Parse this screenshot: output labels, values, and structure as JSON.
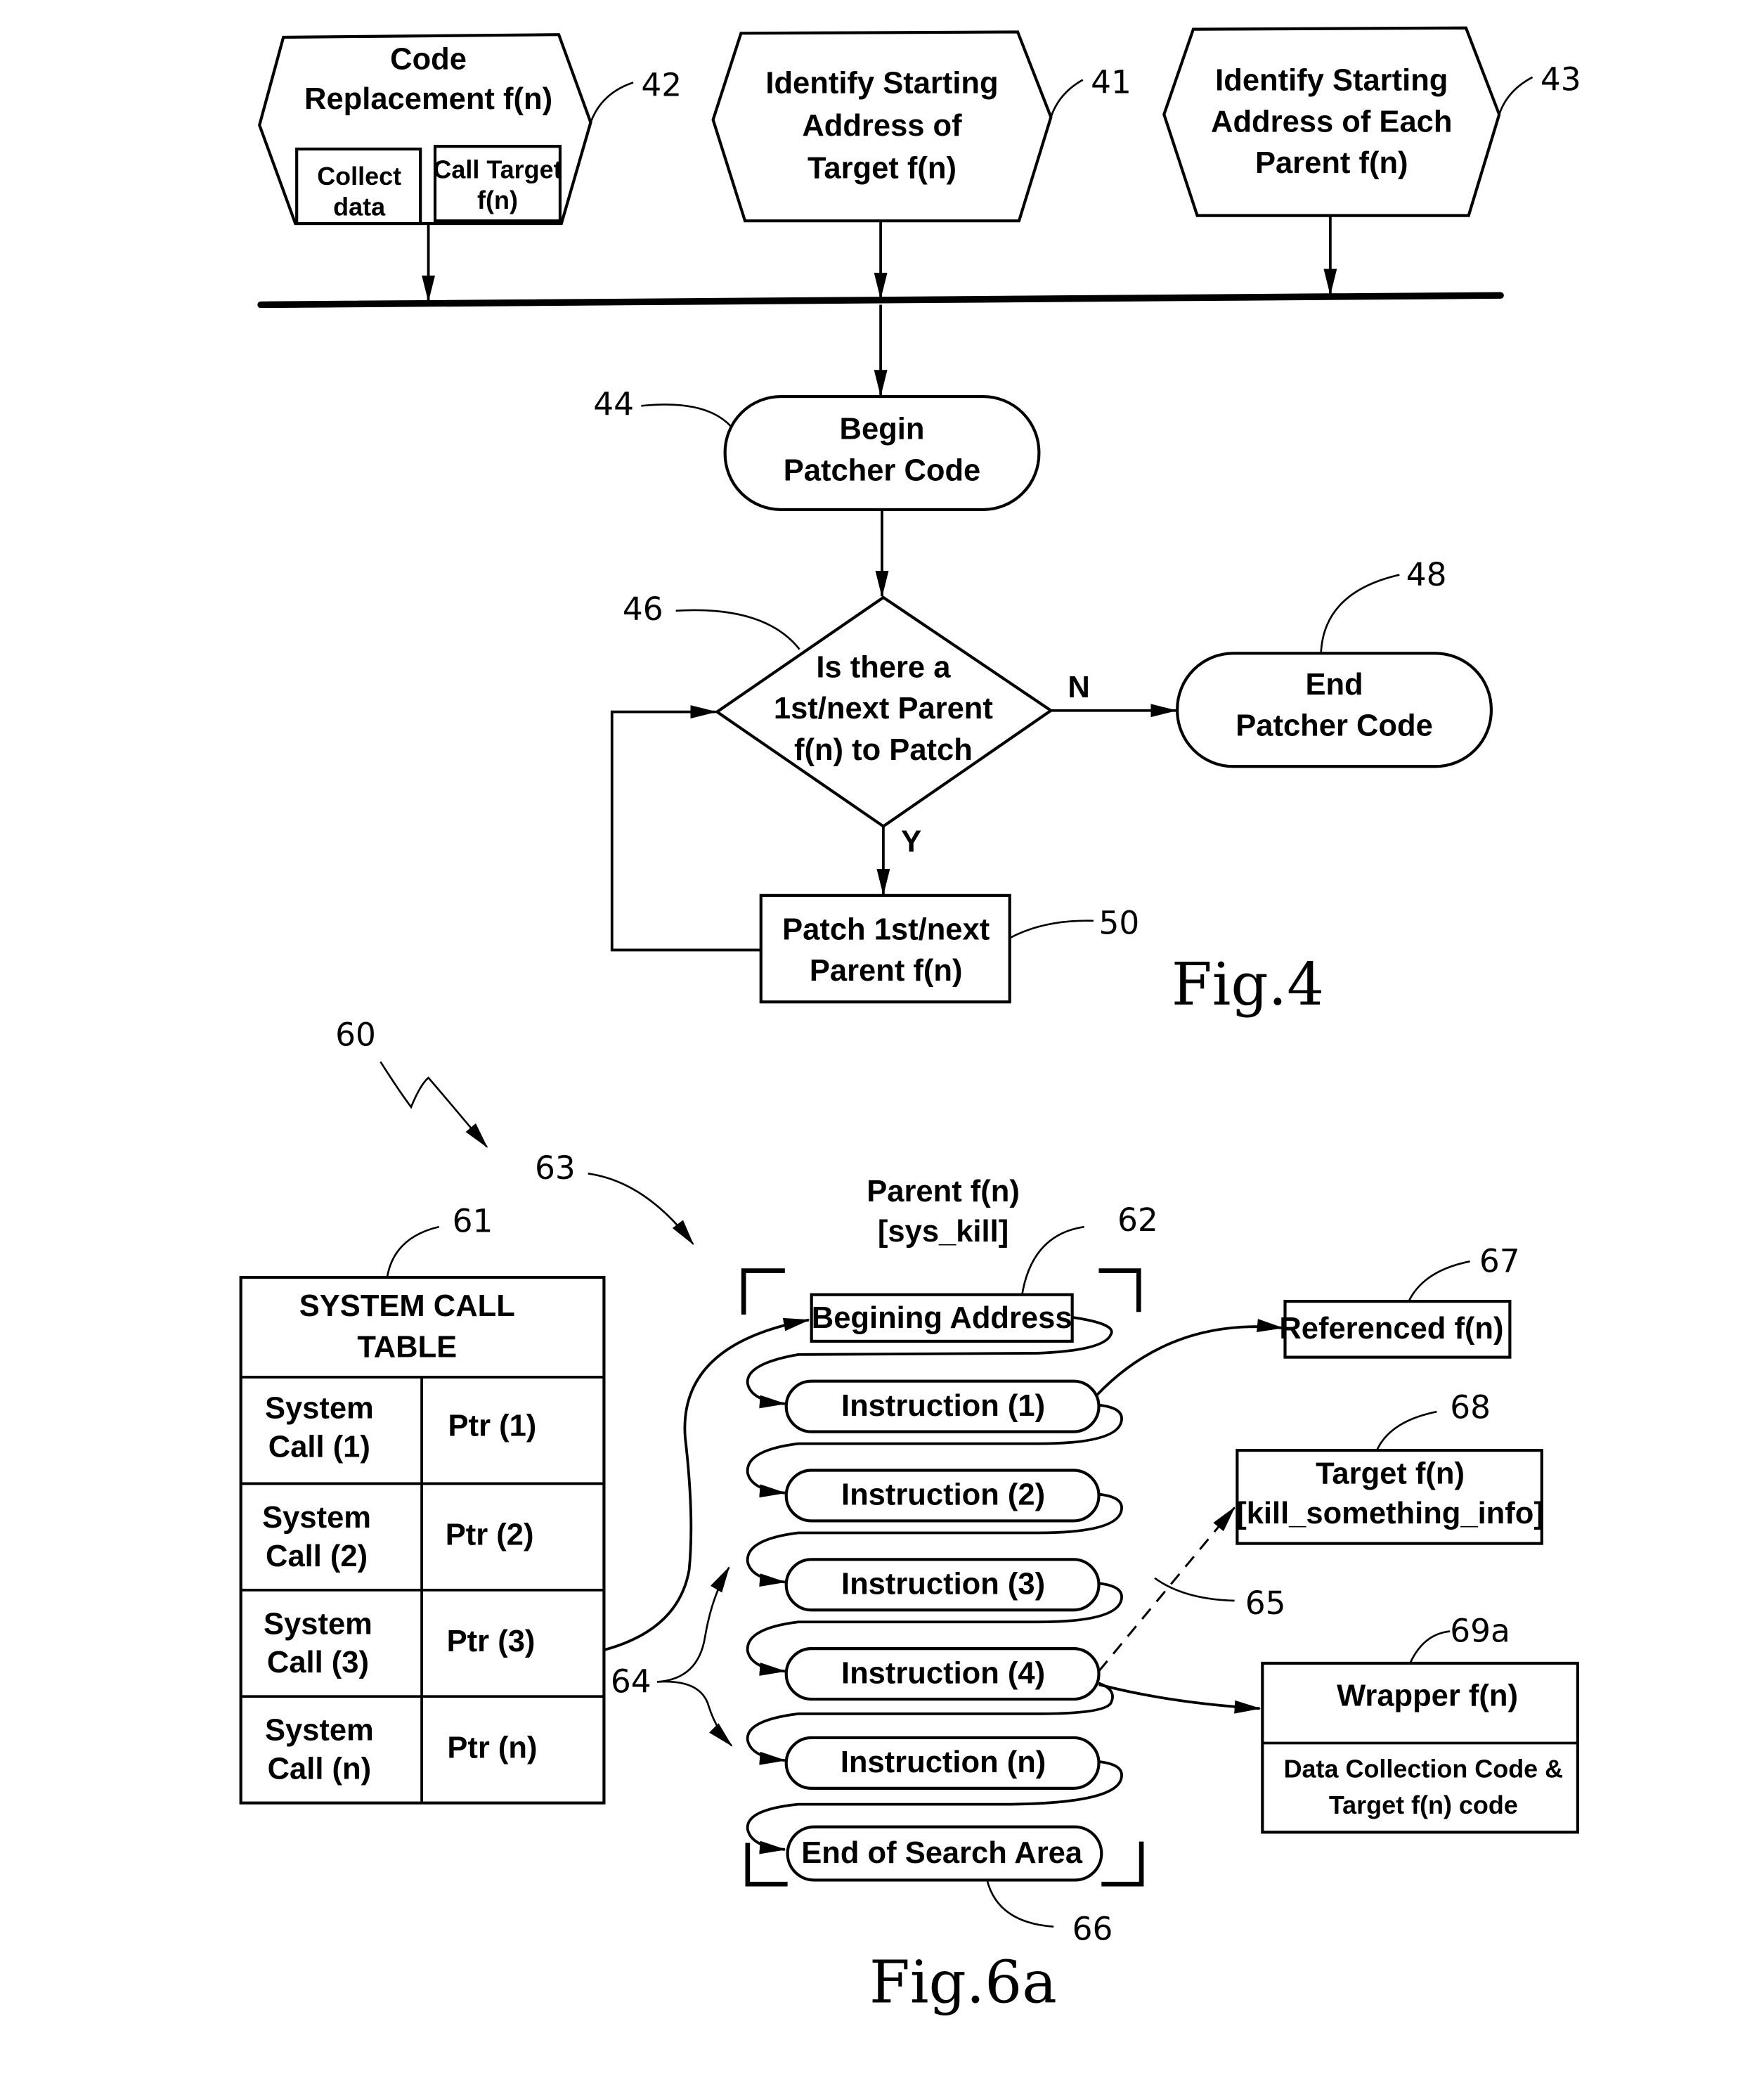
{
  "fig4": {
    "caption": "Fig.4",
    "box42": {
      "ref": "42",
      "line1": "Code",
      "line2": "Replacement f(n)",
      "sub_left": [
        "Collect",
        "data"
      ],
      "sub_right": [
        "Call Target",
        "f(n)"
      ]
    },
    "box41": {
      "ref": "41",
      "lines": [
        "Identify Starting",
        "Address of",
        "Target f(n)"
      ]
    },
    "box43": {
      "ref": "43",
      "lines": [
        "Identify Starting",
        "Address of Each",
        "Parent f(n)"
      ]
    },
    "begin44": {
      "ref": "44",
      "lines": [
        "Begin",
        "Patcher Code"
      ]
    },
    "decision46": {
      "ref": "46",
      "lines": [
        "Is there a",
        "1st/next Parent",
        "f(n) to Patch"
      ],
      "no_label": "N",
      "yes_label": "Y"
    },
    "end48": {
      "ref": "48",
      "lines": [
        "End",
        "Patcher Code"
      ]
    },
    "patch50": {
      "ref": "50",
      "lines": [
        "Patch 1st/next",
        "Parent f(n)"
      ]
    }
  },
  "fig6a": {
    "caption": "Fig.6a",
    "ref60": "60",
    "ref63": "63",
    "ref64": "64",
    "ref65": "65",
    "ref66": "66",
    "table61": {
      "ref": "61",
      "title": [
        "SYSTEM CALL",
        "TABLE"
      ],
      "rows": [
        {
          "call": [
            "System",
            "Call (1)"
          ],
          "ptr": "Ptr (1)"
        },
        {
          "call": [
            "System",
            "Call (2)"
          ],
          "ptr": "Ptr (2)"
        },
        {
          "call": [
            "System",
            "Call (3)"
          ],
          "ptr": "Ptr (3)"
        },
        {
          "call": [
            "System",
            "Call (n)"
          ],
          "ptr": "Ptr (n)"
        }
      ]
    },
    "parent62": {
      "ref": "62",
      "title": [
        "Parent f(n)",
        "[sys_kill]"
      ],
      "begin": "Begining Address",
      "instructions": [
        "Instruction (1)",
        "Instruction (2)",
        "Instruction (3)",
        "Instruction (4)",
        "Instruction (n)"
      ],
      "end": "End of Search Area"
    },
    "referenced67": {
      "ref": "67",
      "label": "Referenced f(n)"
    },
    "target68": {
      "ref": "68",
      "lines": [
        "Target f(n)",
        "[kill_something_info]"
      ]
    },
    "wrapper69a": {
      "ref": "69a",
      "title": "Wrapper f(n)",
      "body": [
        "Data Collection Code &",
        "Target f(n) code"
      ]
    }
  }
}
